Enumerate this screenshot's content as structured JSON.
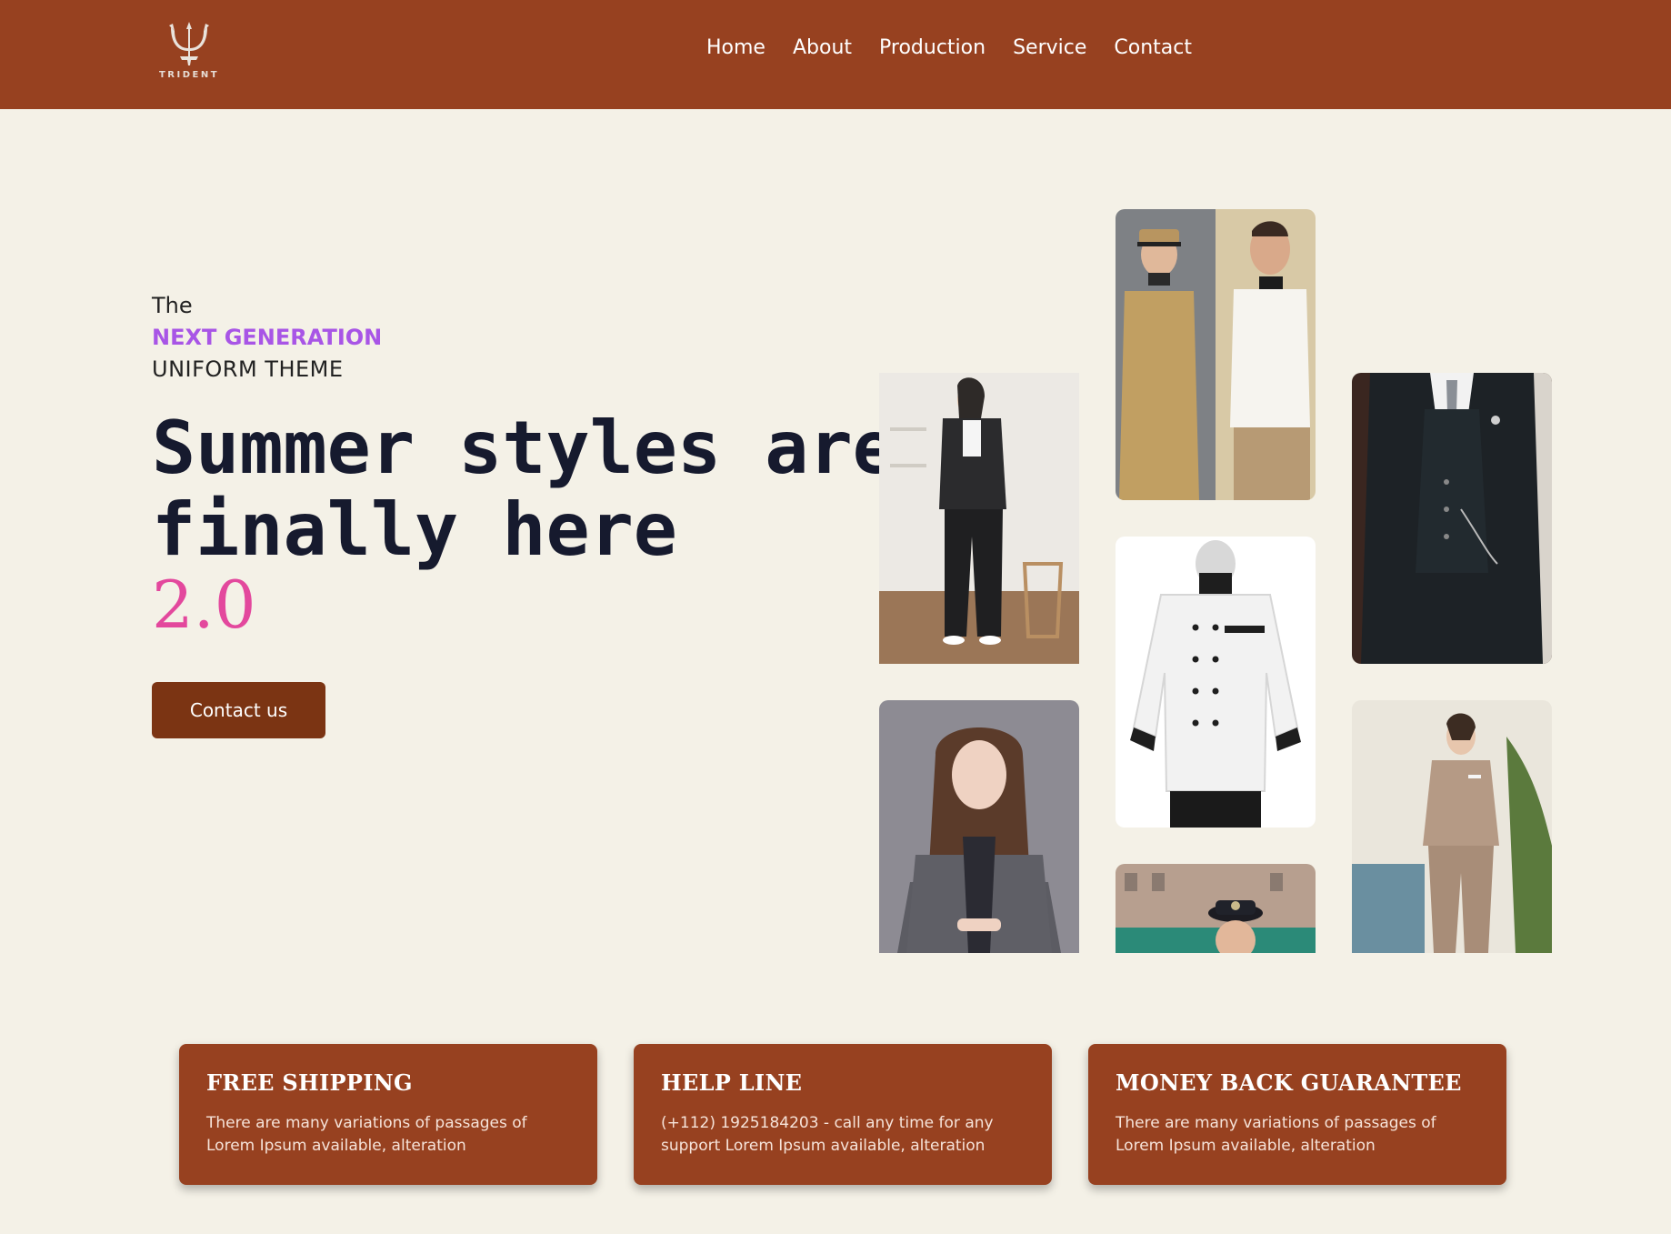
{
  "brand": {
    "name": "TRIDENT",
    "logo_icon": "trident-icon"
  },
  "nav": {
    "items": [
      "Home",
      "About",
      "Production",
      "Service",
      "Contact"
    ]
  },
  "hero": {
    "eyebrow_1": "The",
    "eyebrow_2": "NEXT GENERATION",
    "eyebrow_3": "UNIFORM THEME",
    "headline": "Summer styles are finally here",
    "version": "2.0",
    "cta_label": "Contact us"
  },
  "gallery": [
    {
      "subject": "bellhop-and-chef-uniforms-photo"
    },
    {
      "subject": "woman-black-pantsuit-photo"
    },
    {
      "subject": "man-three-piece-suit-photo"
    },
    {
      "subject": "chef-jacket-photo"
    },
    {
      "subject": "woman-grey-blazer-portrait-photo"
    },
    {
      "subject": "beige-hospitality-uniform-photo"
    },
    {
      "subject": "police-officer-photo"
    }
  ],
  "features": [
    {
      "title": "FREE SHIPPING",
      "text": "There are many variations of passages of Lorem Ipsum available, alteration"
    },
    {
      "title": "HELP LINE",
      "text": "(+112) 1925184203 - call any time for any support Lorem Ipsum available, alteration"
    },
    {
      "title": "MONEY BACK GUARANTEE",
      "text": "There are many variations of passages of Lorem Ipsum available, alteration"
    }
  ],
  "colors": {
    "header": "#974120",
    "background": "#f4f1e7",
    "accent_purple": "#a855e6",
    "accent_pink": "#e3489d",
    "cta": "#7b3413"
  }
}
